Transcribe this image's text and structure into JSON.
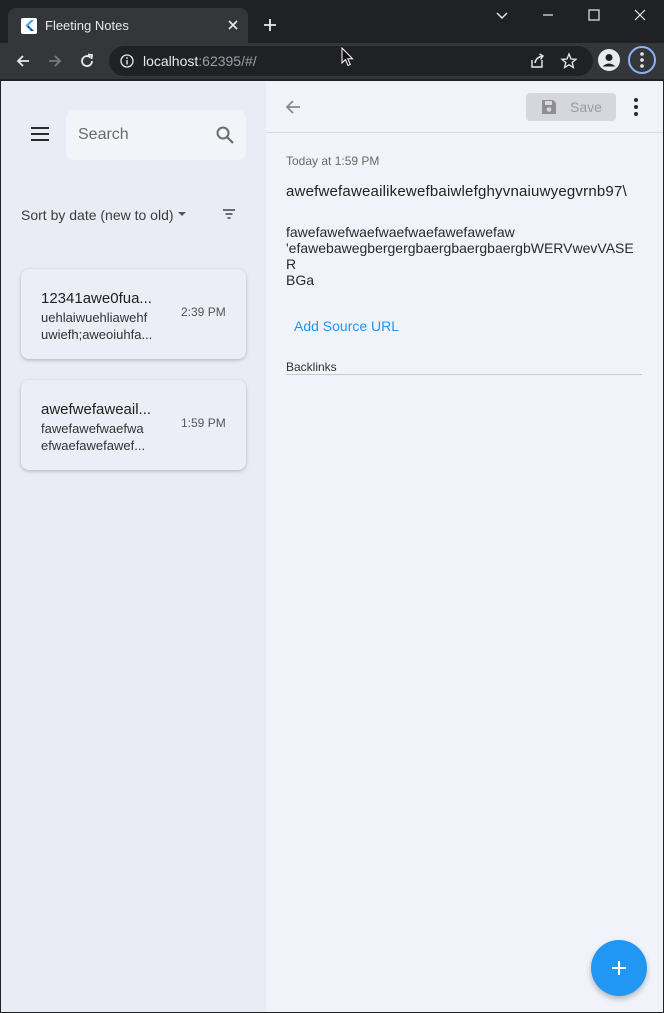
{
  "browser": {
    "tab_title": "Fleeting Notes",
    "url_host": "localhost",
    "url_rest": ":62395/#/"
  },
  "sidebar": {
    "search_placeholder": "Search",
    "sort_label": "Sort by date (new to old)",
    "notes": [
      {
        "title": "12341awe0fua...",
        "body_lines": [
          "uehlaiwuehliawehf",
          "uwiefh;aweoiuhfa..."
        ],
        "time": "2:39 PM"
      },
      {
        "title": "awefwefaweail...",
        "body_lines": [
          "fawefawefwaefwa",
          "efwaefawefawef..."
        ],
        "time": "1:59 PM"
      }
    ]
  },
  "detail": {
    "save_label": "Save",
    "date": "Today at 1:59 PM",
    "title": "awefwefaweailikewefbaiwlefghyvnaiuwyegvrnb97\\",
    "body_lines": [
      "fawefawefwaefwaefwaefawefawefaw",
      "'efawebawegbergergbaergbaergbaergbWERVwevVASER",
      "BGa"
    ],
    "source_link": "Add Source URL",
    "backlinks_label": "Backlinks"
  },
  "colors": {
    "accent": "#2196f3",
    "sidebar_bg": "#e9ebf5",
    "detail_bg": "#f2f3fa",
    "browser_frame": "#202124",
    "toolbar": "#35363a"
  }
}
